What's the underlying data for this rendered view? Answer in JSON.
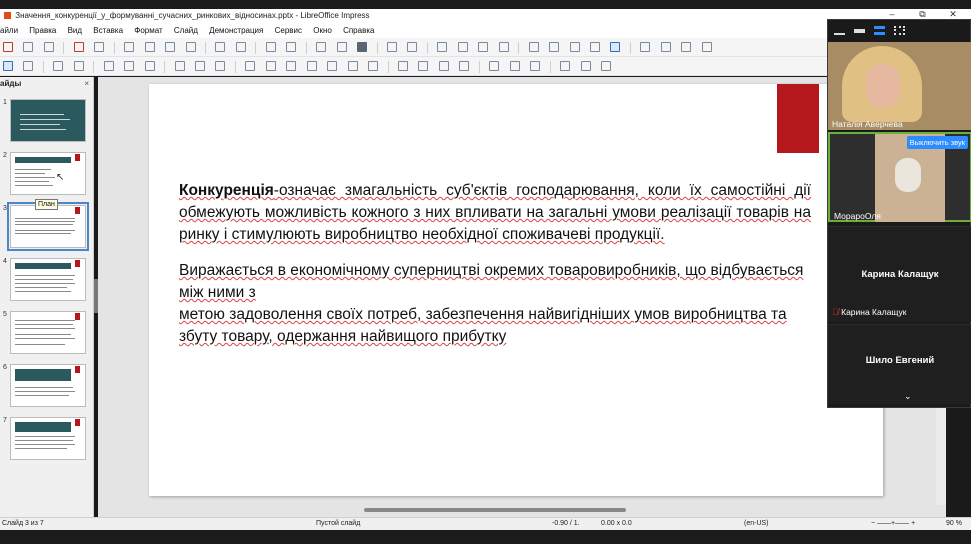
{
  "window": {
    "title": "Значення_конкуренції_у_формуванні_сучасних_ринкових_відносинах.pptx - LibreOffice Impress",
    "controls": {
      "minimize": "–",
      "restore": "⧉",
      "close": "✕"
    }
  },
  "menu": [
    "айли",
    "Правка",
    "Вид",
    "Вставка",
    "Формат",
    "Слайд",
    "Демонстрация",
    "Сервис",
    "Окно",
    "Справка"
  ],
  "slides_panel": {
    "title": "айды",
    "close": "×",
    "tooltip": "План",
    "numbers": [
      "1",
      "2",
      "3",
      "4",
      "5",
      "6",
      "7"
    ]
  },
  "slide": {
    "para1_bold": "Конкуренція",
    "para1_rest": "-означає змагальність суб'єктів господарювання, коли їх самостійні дії обмежують можливість кожного з них впливати на загальні умови реалізації товарів на ринку і стимулюють виробництво необхідної споживачеві продукції.",
    "para2_line1": "Виражається в економічному суперництві окремих товаровиробників, що відбувається між ними з",
    "para2_line2": "метою задоволення своїх потреб, забезпечення найвигідніших умов виробництва та збуту товару, одержання найвищого прибутку"
  },
  "statusbar": {
    "slide_counter": "Слайд 3 из 7",
    "layout": "Пустой слайд",
    "position": "-0.90 / 1.",
    "size": "0.00 x 0.0",
    "language": "(en-US)",
    "zoom": "90 %"
  },
  "zoom": {
    "participants": [
      {
        "name": "Наталія Аверчева"
      },
      {
        "name": "МорароОля",
        "button": "Выключить звук"
      },
      {
        "name": "Карина Калащук",
        "display": "Карина Калащук"
      },
      {
        "name": "Шило Евгений",
        "display": "Шило Евгений"
      }
    ],
    "colors": {
      "active_speaker": "#6bb03a",
      "button": "#2d8cff",
      "mic_muted": "#e03030"
    }
  }
}
